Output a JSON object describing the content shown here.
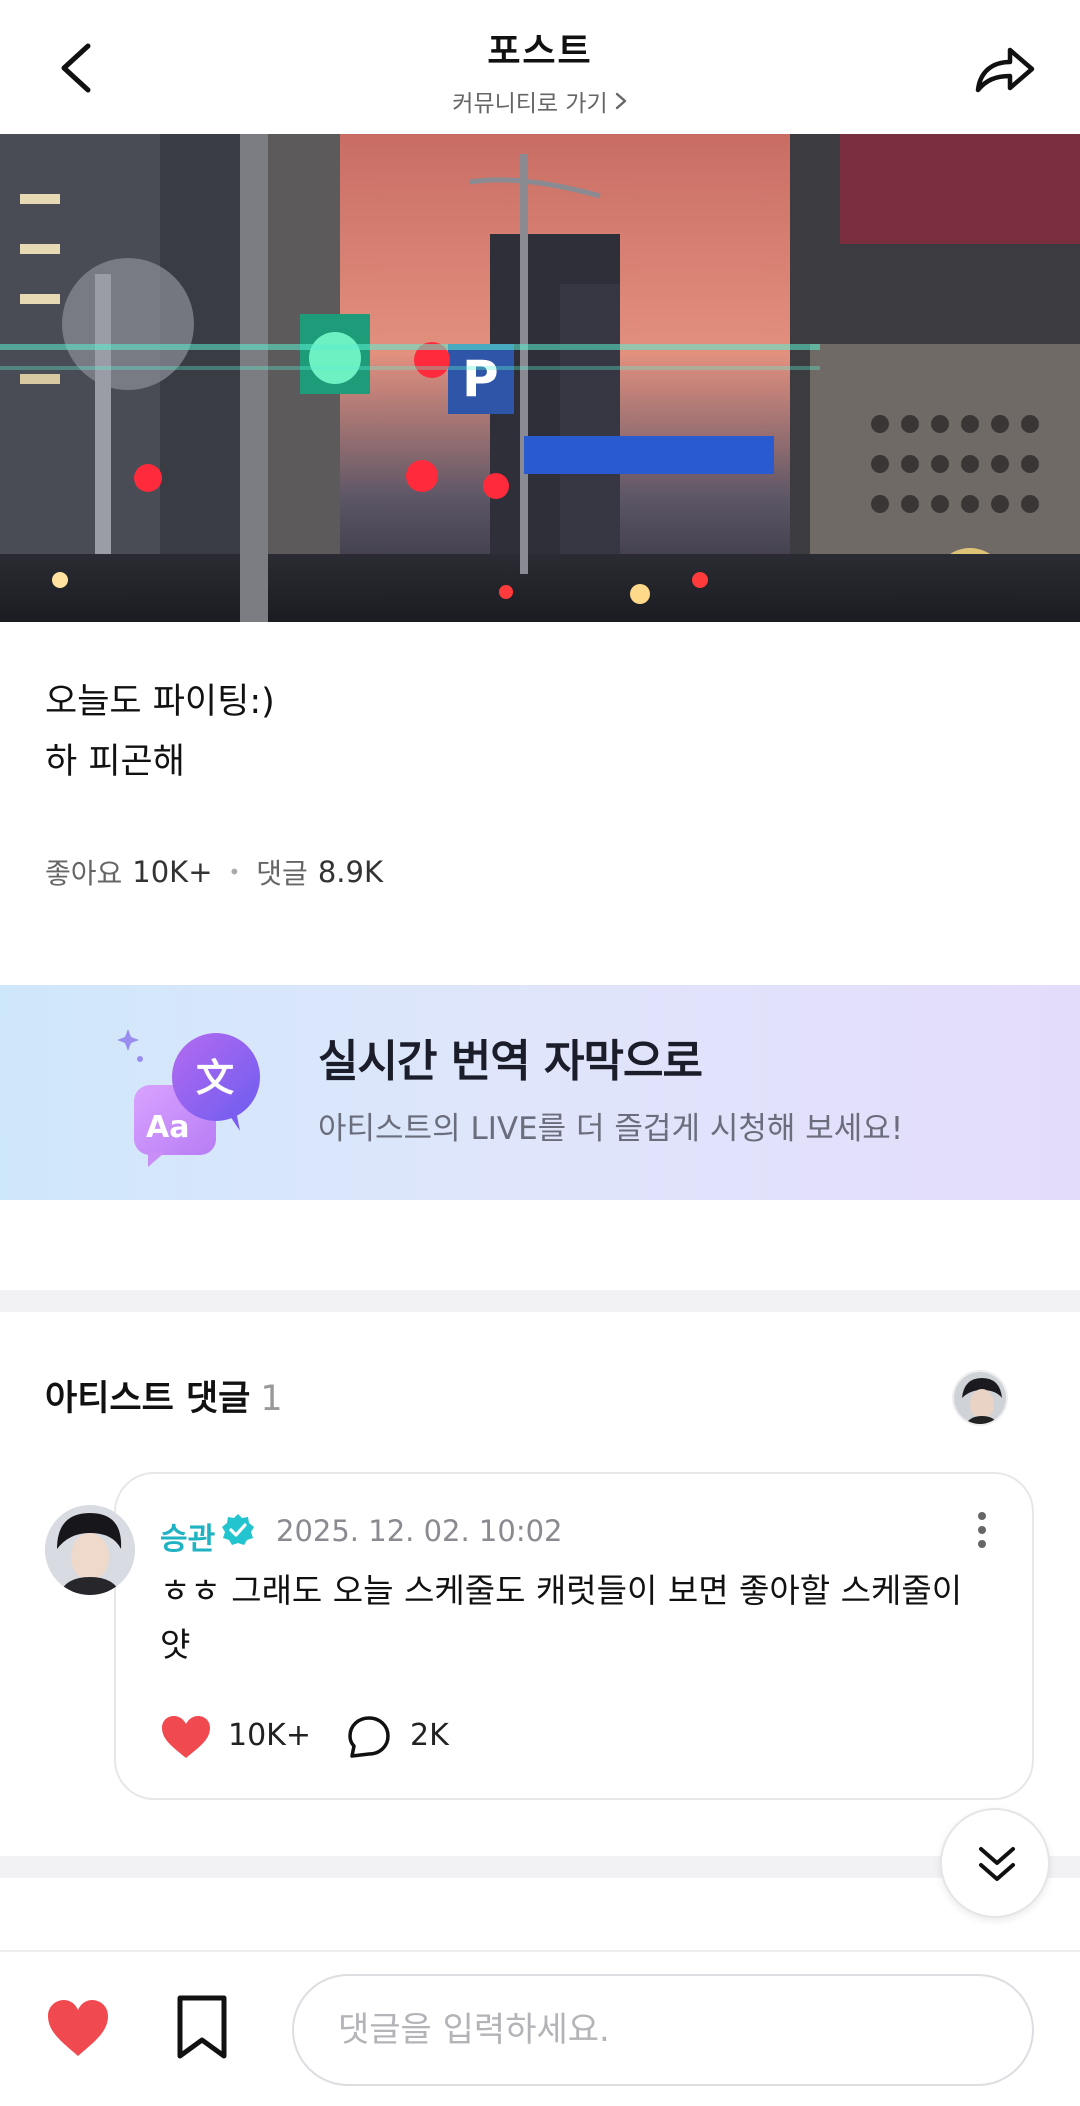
{
  "header": {
    "title": "포스트",
    "subtitle": "커뮤니티로 가기",
    "back_icon": "chevron-left-icon",
    "share_icon": "share-arrow-icon"
  },
  "post": {
    "text_line1": "오늘도 파이팅:)",
    "text_line2": "하 피곤해",
    "likes_label": "좋아요",
    "likes_count": "10K+",
    "comments_label": "댓글",
    "comments_count": "8.9K"
  },
  "banner": {
    "title": "실시간 번역 자막으로",
    "subtitle": "아티스트의 LIVE를 더 즐겁게 시청해 보세요!",
    "icon_glyph_main": "文",
    "icon_glyph_sub": "Aa"
  },
  "artist_comments": {
    "title": "아티스트 댓글",
    "count": "1",
    "comment": {
      "author": "승관",
      "date": "2025. 12. 02. 10:02",
      "text": "ㅎㅎ 그래도 오늘 스케줄도 캐럿들이 보면 좋아할 스케줄이얏",
      "like_count": "10K+",
      "reply_count": "2K"
    }
  },
  "bottom_bar": {
    "input_placeholder": "댓글을 입력하세요."
  },
  "colors": {
    "accent_teal": "#1fb2c2",
    "like_red": "#f0494f",
    "banner_bg": "#dfe6fb"
  }
}
